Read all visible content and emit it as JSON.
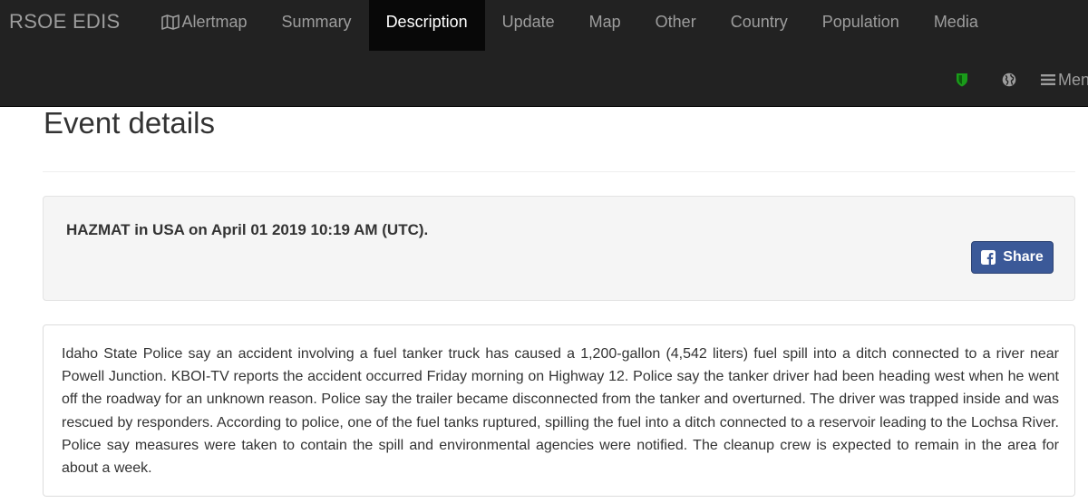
{
  "navbar": {
    "brand": "RSOE EDIS",
    "items": [
      {
        "label": "Alertmap",
        "icon": "map-icon"
      },
      {
        "label": "Summary"
      },
      {
        "label": "Description",
        "active": true
      },
      {
        "label": "Update"
      },
      {
        "label": "Map"
      },
      {
        "label": "Other"
      },
      {
        "label": "Country"
      },
      {
        "label": "Population"
      },
      {
        "label": "Media"
      }
    ],
    "right": {
      "shield_icon": "shield-icon",
      "globe_icon": "globe-icon",
      "menu_label": "Menu"
    },
    "colors": {
      "bar": "#222222",
      "active_bg": "#080808",
      "text": "#9d9d9d",
      "active_text": "#ffffff",
      "shield": "#1a9b1a"
    }
  },
  "page": {
    "title": "Event details"
  },
  "event": {
    "heading": "HAZMAT in USA on April 01 2019 10:19 AM (UTC).",
    "share_label": "Share",
    "share_color": "#3b5998",
    "description": "Idaho State Police say an accident involving a fuel tanker truck has caused a 1,200-gallon (4,542 liters) fuel spill into a ditch connected to a river near Powell Junction. KBOI-TV reports the accident occurred Friday morning on Highway 12. Police say the tanker driver had been heading west when he went off the roadway for an unknown reason. Police say the trailer became disconnected from the tanker and overturned. The driver was trapped inside and was rescued by responders. According to police, one of the fuel tanks ruptured, spilling the fuel into a ditch connected to a reservoir leading to the Lochsa River. Police say measures were taken to contain the spill and environmental agencies were notified. The cleanup crew is expected to remain in the area for about a week."
  }
}
